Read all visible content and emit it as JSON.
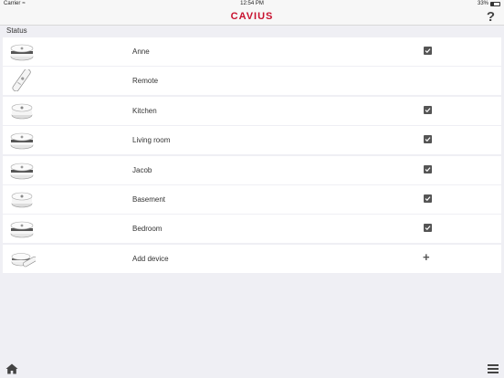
{
  "status_bar": {
    "carrier": "Carrier",
    "time": "12:54 PM",
    "battery_text": "33%",
    "battery_level": 0.33
  },
  "header": {
    "logo": "CAVIUS",
    "help_label": "?"
  },
  "section_title": "Status",
  "devices": [
    {
      "label": "Anne",
      "icon": "smoke-detector-icon",
      "checked": true
    },
    {
      "label": "Remote",
      "icon": "remote-control-icon",
      "checked": false
    },
    {
      "label": "Kitchen",
      "icon": "heat-detector-icon",
      "checked": true
    },
    {
      "label": "Living room",
      "icon": "smoke-detector-icon",
      "checked": true
    },
    {
      "label": "Jacob",
      "icon": "smoke-detector-icon",
      "checked": true
    },
    {
      "label": "Basement",
      "icon": "heat-detector-icon",
      "checked": true
    },
    {
      "label": "Bedroom",
      "icon": "smoke-detector-icon",
      "checked": true
    }
  ],
  "add_device": {
    "label": "Add device",
    "icon": "plus-icon"
  },
  "colors": {
    "brand": "#c8102e",
    "background": "#efeff4",
    "checkbox": "#555555"
  }
}
